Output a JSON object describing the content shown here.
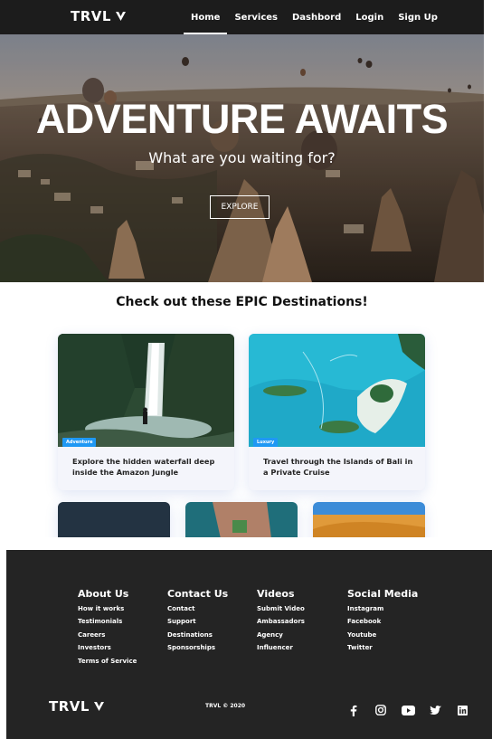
{
  "nav": {
    "logo": "TRVL",
    "links": [
      "Home",
      "Services",
      "Dashbord",
      "Login",
      "Sign Up"
    ]
  },
  "hero": {
    "title": "ADVENTURE AWAITS",
    "subtitle": "What are you waiting for?",
    "button": "EXPLORE"
  },
  "destinations": {
    "heading": "Check out these EPIC Destinations!",
    "cards": [
      {
        "label": "Adventure",
        "text": "Explore the hidden waterfall deep inside the Amazon Jungle"
      },
      {
        "label": "Luxury",
        "text": "Travel through the Islands of Bali in a Private Cruise"
      }
    ]
  },
  "footer": {
    "columns": [
      {
        "title": "About Us",
        "links": [
          "How it works",
          "Testimonials",
          "Careers",
          "Investors",
          "Terms of Service"
        ]
      },
      {
        "title": "Contact Us",
        "links": [
          "Contact",
          "Support",
          "Destinations",
          "Sponsorships"
        ]
      },
      {
        "title": "Videos",
        "links": [
          "Submit Video",
          "Ambassadors",
          "Agency",
          "Influencer"
        ]
      },
      {
        "title": "Social Media",
        "links": [
          "Instagram",
          "Facebook",
          "Youtube",
          "Twitter"
        ]
      }
    ],
    "logo": "TRVL",
    "copyright": "TRVL © 2020",
    "socials": [
      "facebook-icon",
      "instagram-icon",
      "youtube-icon",
      "twitter-icon",
      "linkedin-icon"
    ]
  },
  "colors": {
    "nav_bg": "#1c1c1c",
    "footer_bg": "#242424",
    "label_blue": "#1f98f4"
  }
}
